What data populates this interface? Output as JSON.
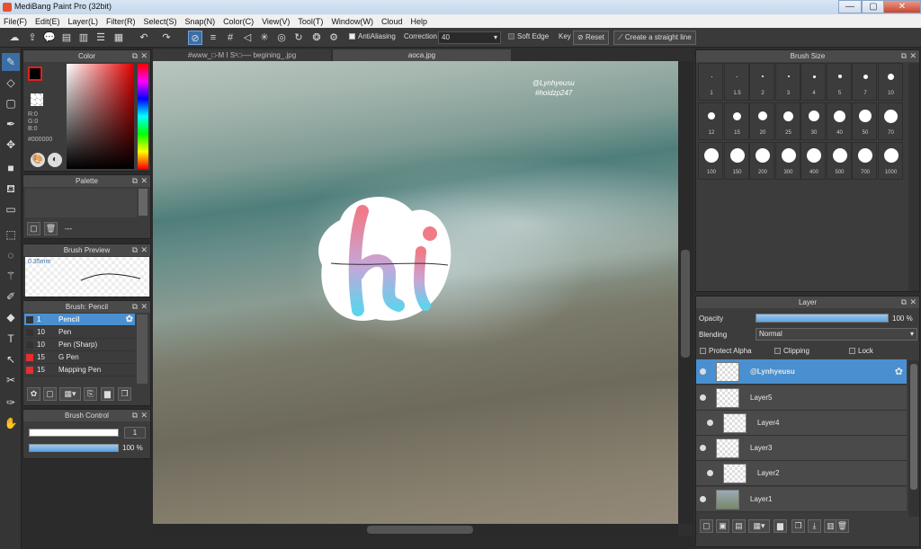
{
  "window": {
    "title": "MediBang Paint Pro (32bit)",
    "minimize": "—",
    "maximize": "▢",
    "close": "✕"
  },
  "menu": [
    "File(F)",
    "Edit(E)",
    "Layer(L)",
    "Filter(R)",
    "Select(S)",
    "Snap(N)",
    "Color(C)",
    "View(V)",
    "Tool(T)",
    "Window(W)",
    "Cloud",
    "Help"
  ],
  "toolbar": {
    "antialiasing_label": "AntiAliasing",
    "correction_label": "Correction",
    "correction_value": "40",
    "soft_edge_label": "Soft Edge",
    "key_label": "Key",
    "reset_label": "Reset",
    "straight_line_label": "Create a straight line"
  },
  "color_panel": {
    "title": "Color",
    "r": "R:0",
    "g": "G:0",
    "b": "B:0",
    "hex": "#000000"
  },
  "palette_panel": {
    "title": "Palette",
    "value": "---"
  },
  "brush_preview": {
    "title": "Brush Preview",
    "size": "0.35mm"
  },
  "brush_panel": {
    "title": "Brush: Pencil",
    "items": [
      {
        "size": "1",
        "name": "Pencil",
        "color": "#333333"
      },
      {
        "size": "10",
        "name": "Pen",
        "color": "#333333"
      },
      {
        "size": "10",
        "name": "Pen (Sharp)",
        "color": "#333333"
      },
      {
        "size": "15",
        "name": "G Pen",
        "color": "#e03030"
      },
      {
        "size": "15",
        "name": "Mapping Pen",
        "color": "#e03030"
      }
    ]
  },
  "brush_control": {
    "title": "Brush Control",
    "size_value": "1",
    "opacity_value": "100 %"
  },
  "canvas_tabs": [
    "#www_□-M I S¹□-— begining_.jpg",
    "aoca.jpg"
  ],
  "canvas": {
    "watermark_line1": "@Lynhyeusu",
    "watermark_line2": "#hoidzp247"
  },
  "brush_size_panel": {
    "title": "Brush Size",
    "sizes": [
      "1",
      "1.5",
      "2",
      "3",
      "4",
      "5",
      "7",
      "10",
      "12",
      "15",
      "20",
      "25",
      "30",
      "40",
      "50",
      "70",
      "100",
      "150",
      "200",
      "300",
      "400",
      "500",
      "700",
      "1000"
    ]
  },
  "layer_panel": {
    "title": "Layer",
    "opacity_label": "Opacity",
    "opacity_value": "100 %",
    "opacity_fraction": 1.0,
    "blending_label": "Blending",
    "blending_value": "Normal",
    "protect_alpha": "Protect Alpha",
    "clipping": "Clipping",
    "lock": "Lock",
    "layers": [
      {
        "name": "@Lynhyeusu",
        "selected": true
      },
      {
        "name": "Layer5",
        "selected": false
      },
      {
        "name": "Layer4",
        "selected": false
      },
      {
        "name": "Layer3",
        "selected": false
      },
      {
        "name": "Layer2",
        "selected": false
      },
      {
        "name": "Layer1",
        "selected": false
      }
    ]
  },
  "colors": {
    "accent": "#4a90d0",
    "panel_bg": "#3c3c3c"
  }
}
